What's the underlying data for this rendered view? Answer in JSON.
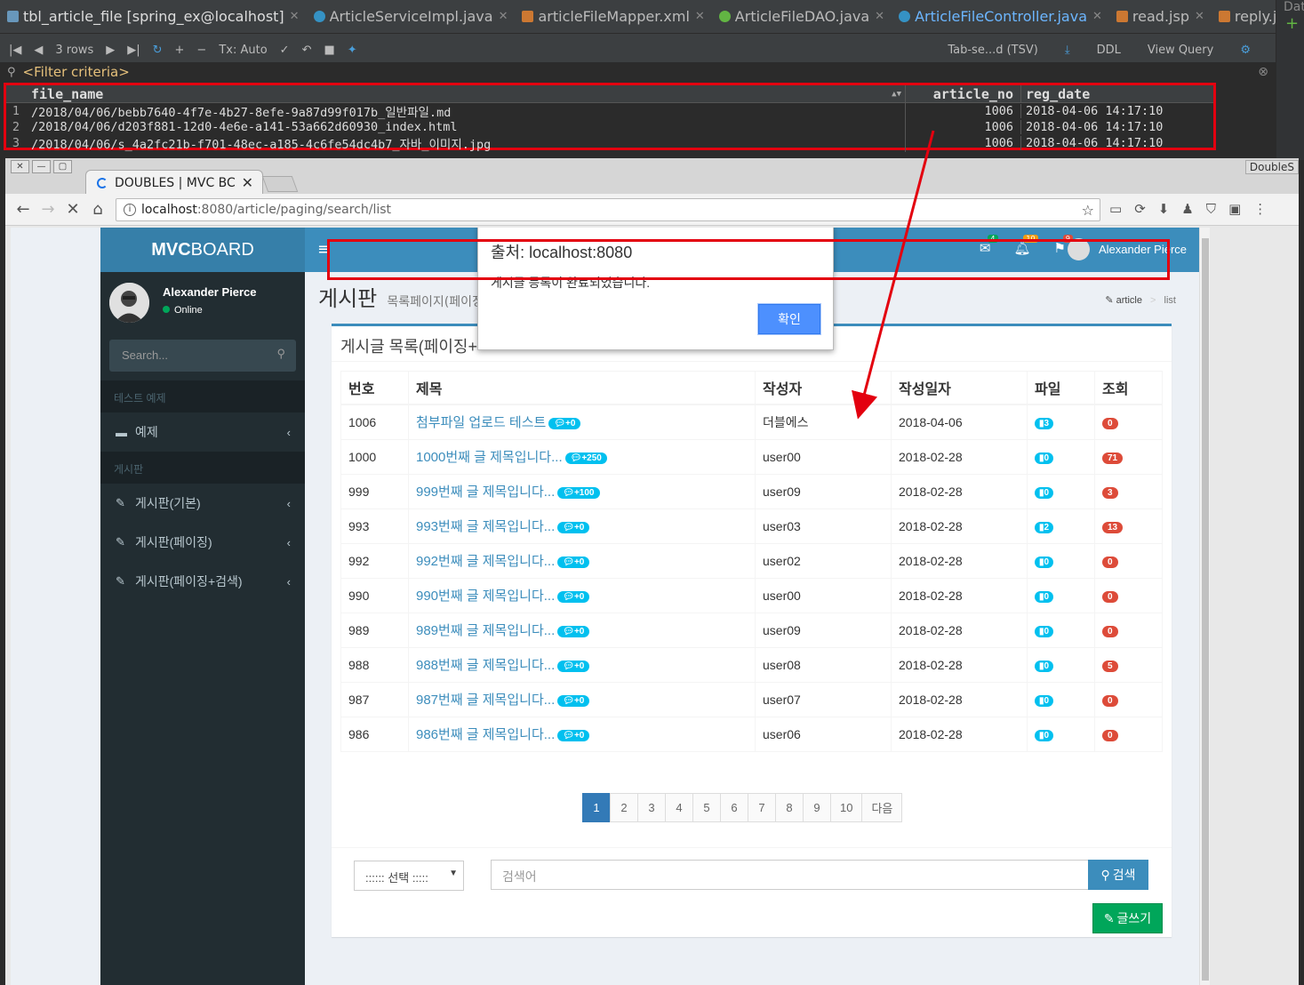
{
  "ide": {
    "tabs": [
      {
        "label": "tbl_article_file [spring_ex@localhost]"
      },
      {
        "label": "ArticleServiceImpl.java"
      },
      {
        "label": "articleFileMapper.xml"
      },
      {
        "label": "ArticleFileDAO.java"
      },
      {
        "label": "ArticleFileController.java"
      },
      {
        "label": "read.jsp"
      },
      {
        "label": "reply.js"
      }
    ],
    "right_panel_label": "Dat",
    "toolbar": {
      "rows": "3 rows",
      "tx": "Tx: Auto",
      "tsv": "Tab-se...d (TSV)",
      "ddl": "DDL",
      "view_query": "View Query"
    },
    "filter_placeholder": "<Filter criteria>",
    "columns": [
      "file_name",
      "article_no",
      "reg_date"
    ],
    "rows": [
      {
        "n": "1",
        "file_name": "/2018/04/06/bebb7640-4f7e-4b27-8efe-9a87d99f017b_일반파일.md",
        "article_no": "1006",
        "reg_date": "2018-04-06 14:17:10"
      },
      {
        "n": "2",
        "file_name": "/2018/04/06/d203f881-12d0-4e6e-a141-53a662d60930_index.html",
        "article_no": "1006",
        "reg_date": "2018-04-06 14:17:10"
      },
      {
        "n": "3",
        "file_name": "/2018/04/06/s_4a2fc21b-f701-48ec-a185-4c6fe54dc4b7_자바_이미지.jpg",
        "article_no": "1006",
        "reg_date": "2018-04-06 14:17:10"
      }
    ]
  },
  "browser": {
    "tab_title": "DOUBLES | MVC BC",
    "profile": "DoubleS",
    "url_host": "localhost",
    "url_rest": ":8080/article/paging/search/list"
  },
  "app": {
    "logo_bold": "MVC",
    "logo_rest": "BOARD",
    "user_name": "Alexander Pierce",
    "user_status": "Online",
    "search_placeholder": "Search...",
    "header_badges": {
      "mail": "4",
      "bell": "10",
      "flag": "9"
    },
    "sidebar": [
      {
        "type": "header",
        "label": "테스트 예제"
      },
      {
        "type": "item",
        "label": "예제",
        "icon": "folder-icon"
      },
      {
        "type": "header",
        "label": "게시판"
      },
      {
        "type": "item",
        "label": "게시판(기본)",
        "icon": "edit-icon"
      },
      {
        "type": "item",
        "label": "게시판(페이징)",
        "icon": "edit-icon"
      },
      {
        "type": "item",
        "label": "게시판(페이징+검색)",
        "icon": "edit-icon"
      }
    ],
    "page_title": "게시판",
    "page_subtitle": "목록페이지(페이징",
    "breadcrumb": {
      "home": "article",
      "current": "list"
    },
    "box_title": "게시글 목록(페이징+ᅵ",
    "table_headers": [
      "번호",
      "제목",
      "작성자",
      "작성일자",
      "파일",
      "조회"
    ],
    "articles": [
      {
        "no": "1006",
        "title": "첨부파일 업로드 테스트",
        "replies": "+0",
        "writer": "더블에스",
        "date": "2018-04-06",
        "files": "3",
        "views": "0"
      },
      {
        "no": "1000",
        "title": "1000번째 글 제목입니다...",
        "replies": "+250",
        "writer": "user00",
        "date": "2018-02-28",
        "files": "0",
        "views": "71"
      },
      {
        "no": "999",
        "title": "999번째 글 제목입니다...",
        "replies": "+100",
        "writer": "user09",
        "date": "2018-02-28",
        "files": "0",
        "views": "3"
      },
      {
        "no": "993",
        "title": "993번째 글 제목입니다...",
        "replies": "+0",
        "writer": "user03",
        "date": "2018-02-28",
        "files": "2",
        "views": "13"
      },
      {
        "no": "992",
        "title": "992번째 글 제목입니다...",
        "replies": "+0",
        "writer": "user02",
        "date": "2018-02-28",
        "files": "0",
        "views": "0"
      },
      {
        "no": "990",
        "title": "990번째 글 제목입니다...",
        "replies": "+0",
        "writer": "user00",
        "date": "2018-02-28",
        "files": "0",
        "views": "0"
      },
      {
        "no": "989",
        "title": "989번째 글 제목입니다...",
        "replies": "+0",
        "writer": "user09",
        "date": "2018-02-28",
        "files": "0",
        "views": "0"
      },
      {
        "no": "988",
        "title": "988번째 글 제목입니다...",
        "replies": "+0",
        "writer": "user08",
        "date": "2018-02-28",
        "files": "0",
        "views": "5"
      },
      {
        "no": "987",
        "title": "987번째 글 제목입니다...",
        "replies": "+0",
        "writer": "user07",
        "date": "2018-02-28",
        "files": "0",
        "views": "0"
      },
      {
        "no": "986",
        "title": "986번째 글 제목입니다...",
        "replies": "+0",
        "writer": "user06",
        "date": "2018-02-28",
        "files": "0",
        "views": "0"
      }
    ],
    "pages": [
      "1",
      "2",
      "3",
      "4",
      "5",
      "6",
      "7",
      "8",
      "9",
      "10",
      "다음"
    ],
    "search_type": ":::::: 선택 :::::",
    "keyword_placeholder": "검색어",
    "search_button": "검색",
    "write_button": "글쓰기"
  },
  "alert": {
    "title": "출처: localhost:8080",
    "message": "게시글 등록이 완료되었습니다.",
    "ok": "확인"
  },
  "colors": {
    "highlight": "#e3000f",
    "sidebar": "#222d32",
    "header": "#3c8dbc",
    "badge_info": "#00c0ef",
    "badge_danger": "#dd4b39",
    "success": "#00a65a"
  }
}
